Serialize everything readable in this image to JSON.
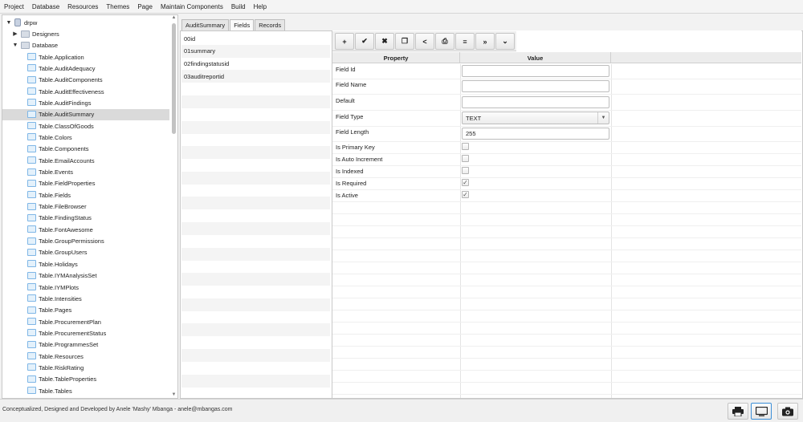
{
  "menubar": {
    "items": [
      "Project",
      "Database",
      "Resources",
      "Themes",
      "Page",
      "Maintain Components",
      "Build",
      "Help"
    ]
  },
  "tree": {
    "root": {
      "label": "drpw",
      "expanded": true,
      "icon": "database-icon"
    },
    "designers": {
      "label": "Designers",
      "expanded": false,
      "icon": "folder-icon"
    },
    "database": {
      "label": "Database",
      "expanded": true,
      "icon": "folder-icon"
    },
    "tables": [
      "Table.Application",
      "Table.AuditAdequacy",
      "Table.AuditComponents",
      "Table.AuditEffectiveness",
      "Table.AuditFindings",
      "Table.AuditSummary",
      "Table.ClassOfGoods",
      "Table.Colors",
      "Table.Components",
      "Table.EmailAccounts",
      "Table.Events",
      "Table.FieldProperties",
      "Table.Fields",
      "Table.FileBrowser",
      "Table.FindingStatus",
      "Table.FontAwesome",
      "Table.GroupPermissions",
      "Table.GroupUsers",
      "Table.Holidays",
      "Table.IYMAnalysisSet",
      "Table.IYMPlots",
      "Table.Intensities",
      "Table.Pages",
      "Table.ProcurementPlan",
      "Table.ProcurementStatus",
      "Table.ProgrammesSet",
      "Table.Resources",
      "Table.RiskRating",
      "Table.TableProperties",
      "Table.Tables"
    ],
    "selected": "Table.AuditSummary"
  },
  "tabs": [
    {
      "label": "AuditSummary",
      "active": false
    },
    {
      "label": "Fields",
      "active": true
    },
    {
      "label": "Records",
      "active": false
    }
  ],
  "fields": [
    "00id",
    "01summary",
    "02findingstatusid",
    "03auditreportid"
  ],
  "toolbar": {
    "buttons": [
      {
        "name": "add-button",
        "glyph": "+",
        "icon": "plus-icon"
      },
      {
        "name": "save-button",
        "glyph": "✔",
        "icon": "check-icon"
      },
      {
        "name": "delete-button",
        "glyph": "✖",
        "icon": "times-icon"
      },
      {
        "name": "copy-button",
        "glyph": "❐",
        "icon": "copy-icon"
      },
      {
        "name": "share-button",
        "glyph": "<",
        "icon": "share-icon"
      },
      {
        "name": "print-button",
        "glyph": "⎙",
        "icon": "print-icon"
      },
      {
        "name": "list-button",
        "glyph": "≡",
        "icon": "list-icon"
      },
      {
        "name": "forward-button",
        "glyph": "»",
        "icon": "double-chevron-right-icon"
      },
      {
        "name": "expand-button",
        "glyph": "⌄",
        "icon": "chevron-down-icon"
      }
    ]
  },
  "grid": {
    "header_property": "Property",
    "header_value": "Value",
    "properties": {
      "field_id": {
        "label": "Field Id",
        "value": ""
      },
      "field_name": {
        "label": "Field Name",
        "value": ""
      },
      "default": {
        "label": "Default",
        "value": ""
      },
      "field_type": {
        "label": "Field Type",
        "value": "TEXT"
      },
      "field_length": {
        "label": "Field Length",
        "value": "255"
      },
      "is_primary_key": {
        "label": "Is Primary Key",
        "checked": false
      },
      "is_auto_increment": {
        "label": "Is Auto Increment",
        "checked": false
      },
      "is_indexed": {
        "label": "Is Indexed",
        "checked": false
      },
      "is_required": {
        "label": "Is Required",
        "checked": true
      },
      "is_active": {
        "label": "Is Active",
        "checked": true
      }
    }
  },
  "status": {
    "text": "Conceptualized, Designed and Developed by Anele 'Mashy' Mbanga - anele@mbangas.com",
    "buttons": [
      {
        "name": "print-status-button",
        "icon": "printer-icon",
        "active": false
      },
      {
        "name": "display-status-button",
        "icon": "monitor-icon",
        "active": true
      },
      {
        "name": "camera-status-button",
        "icon": "camera-icon",
        "active": false
      }
    ]
  },
  "colors": {
    "accent": "#3b8fd8",
    "selection": "#dadada",
    "table_icon": "#7eb6e6"
  }
}
